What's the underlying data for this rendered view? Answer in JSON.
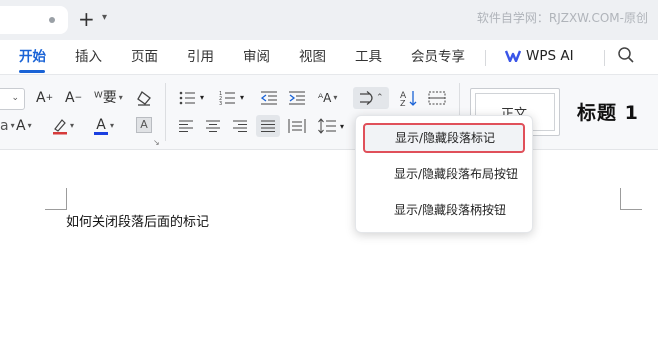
{
  "titlebar": {
    "new_tab_symbol": "+",
    "new_tab_caret": "⌄",
    "watermark": "软件自学网：RJZXW.COM-原创"
  },
  "menu": {
    "tabs": [
      {
        "label": "开始",
        "active": true
      },
      {
        "label": "插入"
      },
      {
        "label": "页面"
      },
      {
        "label": "引用"
      },
      {
        "label": "审阅"
      },
      {
        "label": "视图"
      },
      {
        "label": "工具"
      },
      {
        "label": "会员专享"
      }
    ],
    "ai_label": "WPS AI",
    "accent": "#1a63d6"
  },
  "ribbon": {
    "style_normal": "正文",
    "style_heading": "标题 1",
    "font_color": "#1a3fe0",
    "highlight_color": "#d63a3a"
  },
  "document": {
    "text": "如何关闭段落后面的标记"
  },
  "dropdown": {
    "items": [
      {
        "label": "显示/隐藏段落标记",
        "highlighted": true
      },
      {
        "label": "显示/隐藏段落布局按钮"
      },
      {
        "label": "显示/隐藏段落柄按钮"
      }
    ],
    "highlight_border": "#e0505a"
  }
}
